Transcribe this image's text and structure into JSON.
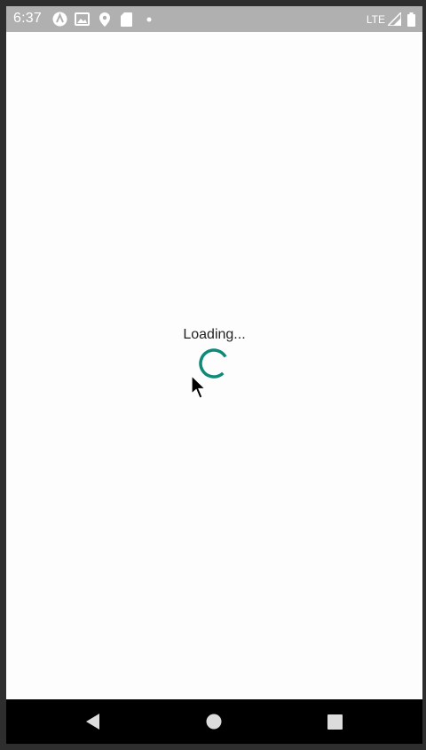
{
  "status_bar": {
    "time": "6:37",
    "network": "LTE",
    "icons_left": [
      "app-icon",
      "gallery-icon",
      "location-icon",
      "sd-card-icon",
      "dot-icon"
    ],
    "icons_right": [
      "signal-icon",
      "battery-icon"
    ]
  },
  "main": {
    "loading_text": "Loading...",
    "spinner_color": "#0e8a78"
  },
  "nav_bar": {
    "buttons": [
      "back-icon",
      "home-icon",
      "recents-icon"
    ]
  }
}
